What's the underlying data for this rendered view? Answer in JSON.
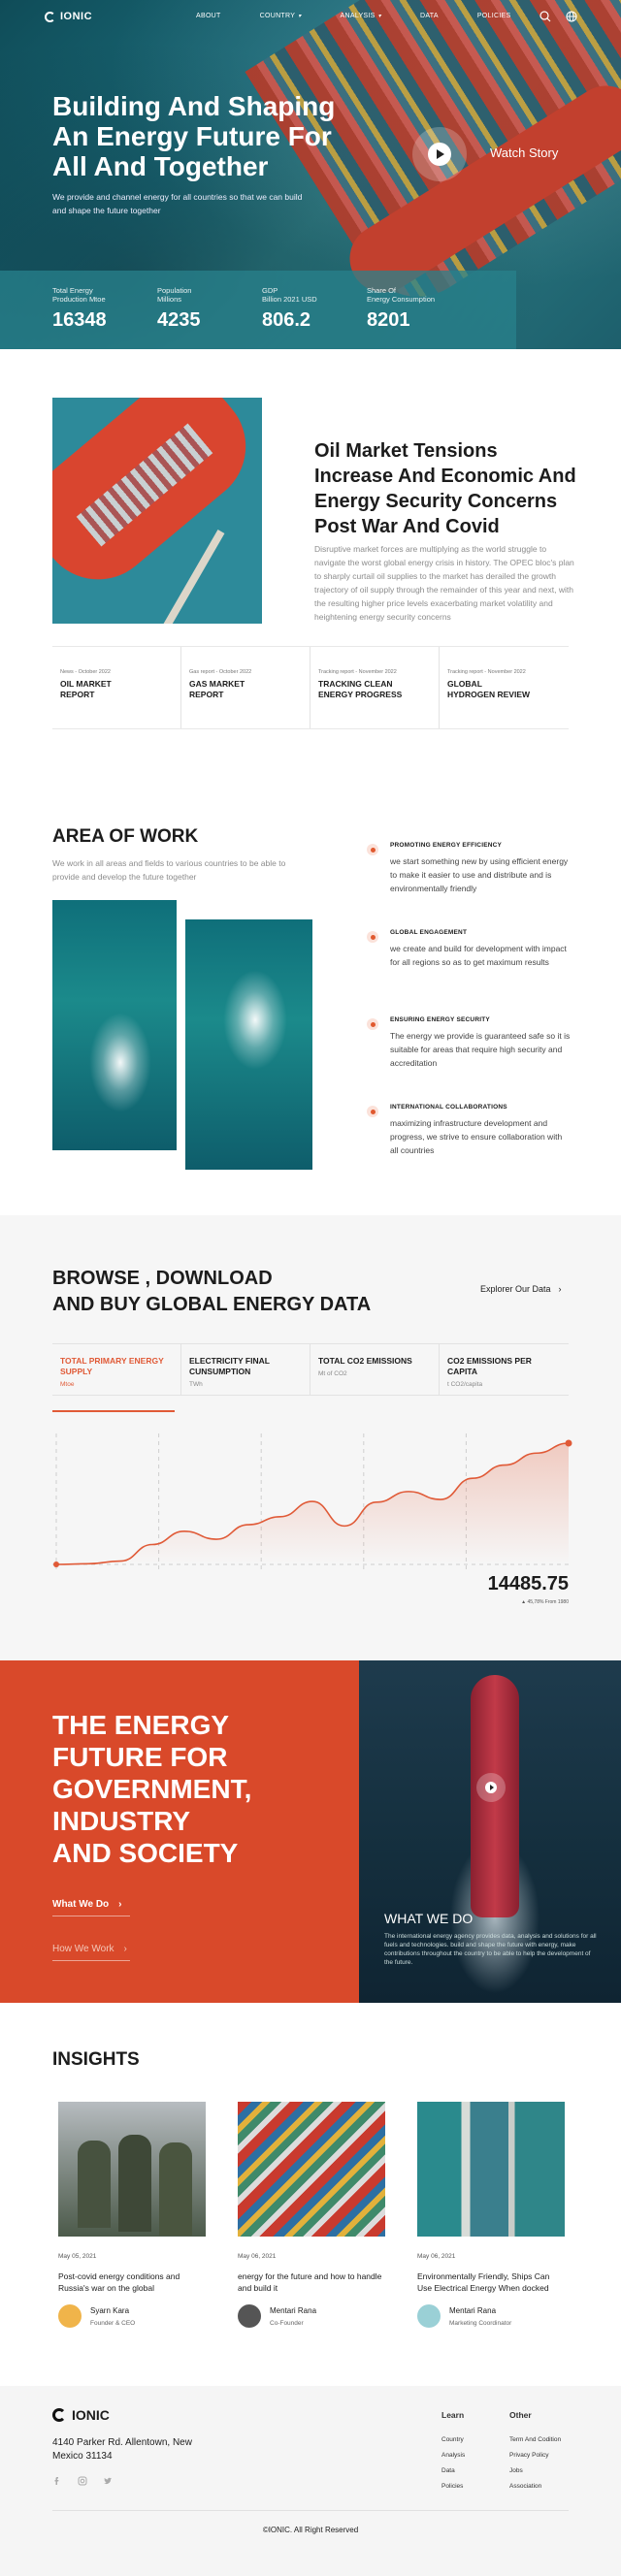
{
  "brand": {
    "name": "IONIC"
  },
  "nav": {
    "items": [
      {
        "label": "ABOUT"
      },
      {
        "label": "COUNTRY"
      },
      {
        "label": "ANALYSIS"
      },
      {
        "label": "DATA"
      },
      {
        "label": "POLICIES"
      }
    ]
  },
  "icons": {
    "search": "search-icon",
    "globe": "globe-icon",
    "play": "play-icon",
    "arrow": "arrow-right-icon",
    "fb": "facebook-icon",
    "ig": "instagram-icon",
    "tw": "twitter-icon"
  },
  "hero": {
    "title": "Building And Shaping An Energy Future For All And Together",
    "subtitle": "We provide and channel energy for all countries so that we can build and shape the future together",
    "watch": "Watch Story",
    "stats": [
      {
        "label": "Total Energy\nProduction Mtoe",
        "value": "16348"
      },
      {
        "label": "Population\nMillions",
        "value": "4235"
      },
      {
        "label": "GDP\nBillion 2021 USD",
        "value": "806.2"
      },
      {
        "label": "Share Of\nEnergy Consumption",
        "value": "8201"
      }
    ]
  },
  "market": {
    "title": "Oil Market Tensions Increase And Economic And Energy Security Concerns Post War And Covid",
    "body": "Disruptive market forces are multiplying as the world struggle to navigate the worst global energy crisis in history. The OPEC bloc's plan to sharply curtail oil supplies to the market has derailed the growth trajectory of oil supply through the remainder of this year and next, with the resulting higher price levels exacerbating market volatility and heightening energy security concerns",
    "reports": [
      {
        "meta": "News - October 2022",
        "title": "OIL MARKET\nREPORT"
      },
      {
        "meta": "Gas report - October 2022",
        "title": "GAS MARKET\nREPORT"
      },
      {
        "meta": "Tracking report - November 2022",
        "title": "TRACKING CLEAN\nENERGY PROGRESS"
      },
      {
        "meta": "Tracking report - November 2022",
        "title": "GLOBAL\nHYDROGEN REVIEW"
      }
    ]
  },
  "area": {
    "title": "AREA OF WORK",
    "subtitle": "We work in all areas and fields to various countries to be able to provide and develop the future together",
    "items": [
      {
        "heading": "PROMOTING ENERGY EFFICIENCY",
        "text": "we start something new by using efficient energy to make it easier to use and distribute and is environmentally friendly"
      },
      {
        "heading": "GLOBAL ENGAGEMENT",
        "text": "we create and build for development with impact for all regions so as to get maximum results"
      },
      {
        "heading": "ENSURING ENERGY SECURITY",
        "text": "The energy we provide is guaranteed safe so it is suitable for areas that require high security and accreditation"
      },
      {
        "heading": "INTERNATIONAL COLLABORATIONS",
        "text": "maximizing infrastructure development and progress, we strive to ensure collaboration with all countries"
      }
    ]
  },
  "browse": {
    "title": "BROWSE , DOWNLOAD\nAND BUY GLOBAL ENERGY DATA",
    "button": "Explorer Our Data",
    "tabs": [
      {
        "title": "TOTAL PRIMARY ENERGY SUPPLY",
        "unit": "Mtoe"
      },
      {
        "title": "ELECTRICITY FINAL CUNSUMPTION",
        "unit": "TWh"
      },
      {
        "title": "TOTAL CO2 EMISSIONS",
        "unit": "Mt of CO2"
      },
      {
        "title": "CO2 EMISSIONS PER CAPITA",
        "unit": "t CO2/capita"
      }
    ],
    "value": "14485.75",
    "note": "▲ 45,78% From 1980"
  },
  "chart_data": {
    "type": "area",
    "values": [
      0,
      1,
      5,
      30,
      50,
      38,
      60,
      72,
      95,
      58,
      94,
      110,
      98,
      130,
      150,
      168,
      183
    ],
    "accent": "#e05a37"
  },
  "energy": {
    "title": "THE ENERGY\nFUTURE FOR\nGOVERNMENT,\nINDUSTRY\nAND SOCIETY",
    "link1": "What We Do",
    "link2": "How We Work",
    "wwd_title": "WHAT WE DO",
    "wwd_text": "The international energy agency provides data, analysis and solutions for all fuels and technologies. build and shape the future with energy, make contributions throughout the country to be able to help the development of the future."
  },
  "insights": {
    "title": "INSIGHTS",
    "cards": [
      {
        "date": "May 05, 2021",
        "title": "Post-covid energy conditions and Russia's war on the global",
        "author": "Syarn Kara",
        "role": "Founder & CEO"
      },
      {
        "date": "May 06, 2021",
        "title": "energy for the future and how to handle and build it",
        "author": "Mentari Rana",
        "role": "Co-Founder"
      },
      {
        "date": "May 06, 2021",
        "title": "Environmentally Friendly, Ships Can Use Electrical Energy When docked",
        "author": "Mentari Rana",
        "role": "Marketing Coordinator"
      }
    ]
  },
  "footer": {
    "address": "4140 Parker Rd. Allentown, New Mexico 31134",
    "learn_title": "Learn",
    "learn": [
      "Country",
      "Analysis",
      "Data",
      "Policies"
    ],
    "other_title": "Other",
    "other": [
      "Term And Codition",
      "Privacy Policy",
      "Jobs",
      "Association"
    ],
    "copyright": "©IONIC. All Right Reserved"
  }
}
